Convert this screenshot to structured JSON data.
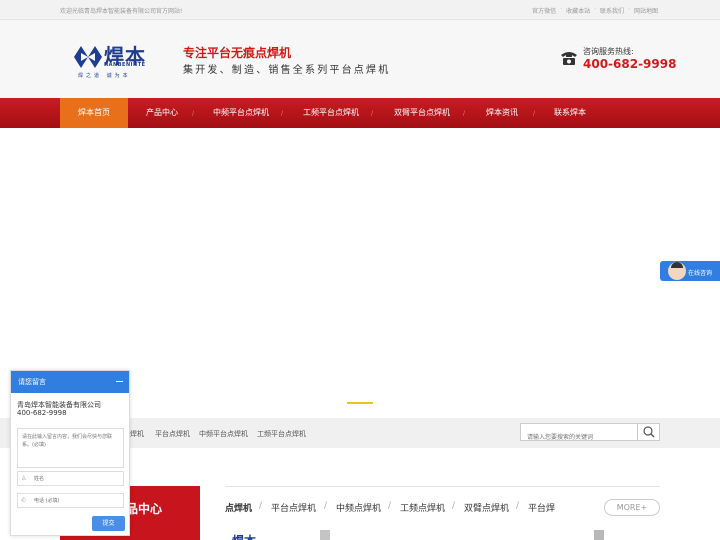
{
  "topbar": {
    "welcome": "欢迎光临青岛焊本智能装备有限公司官方网站!",
    "links": [
      "官方微信",
      "收藏本站",
      "联系我们",
      "网站地图"
    ]
  },
  "header": {
    "brand": "焊本",
    "brand_en": "HANBENINTE",
    "motto": "焊之道 诚为本",
    "slogan1": "专注平台无痕点焊机",
    "slogan2": "集开发、制造、销售全系列平台点焊机",
    "hotline_label": "咨询服务热线:",
    "hotline_number": "400-682-9998"
  },
  "nav": {
    "items": [
      "焊本首页",
      "产品中心",
      "中频平台点焊机",
      "工频平台点焊机",
      "双臂平台点焊机",
      "焊本资讯",
      "联系焊本"
    ]
  },
  "subbar": {
    "keywords": [
      "焊机",
      "平台点焊机",
      "中频平台点焊机",
      "工频平台点焊机"
    ],
    "search_placeholder": "请输入您要搜索的关键词"
  },
  "products": {
    "box_title": "品中心",
    "tabs": [
      "点焊机",
      "平台点焊机",
      "中频点焊机",
      "工频点焊机",
      "双臂点焊机",
      "平台焊"
    ],
    "more": "MORE+",
    "thumb_brand": "焊本"
  },
  "chat": {
    "title": "请您留言",
    "company": "青岛焊本智能装备有限公司",
    "phone": "400-682-9998",
    "message_placeholder": "请在此输入留言内容，我们会尽快与您联系。(必填)",
    "name_placeholder": "姓名",
    "tel_placeholder": "电话 (必填)",
    "submit": "提交"
  },
  "online": {
    "label": "在线咨询"
  },
  "colors": {
    "nav_red": "#c81c22",
    "nav_active": "#e8701a",
    "slogan_red": "#d01a1a",
    "brand_blue": "#1f3d8f",
    "chat_blue": "#2f7ee0",
    "banner_indicator": "#f0c020"
  },
  "icons": [
    "logo-mark-icon",
    "phone-icon",
    "search-icon",
    "minimize-icon",
    "user-icon",
    "phone-small-icon"
  ]
}
